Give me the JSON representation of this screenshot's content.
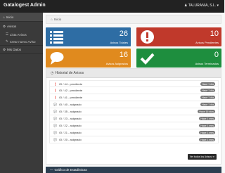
{
  "app": {
    "brand": "Gatalogest Admin",
    "user_label": "TALURANIA, S.L. ▾"
  },
  "sidebar": {
    "items": [
      {
        "label": "Inicio",
        "icon": "home-icon"
      },
      {
        "label": "Avisos",
        "icon": "gear-icon"
      },
      {
        "label": "Lista Avisos",
        "icon": "list-icon"
      },
      {
        "label": "Crear nuevo Aviso",
        "icon": "edit-icon"
      },
      {
        "label": "Mis Datos",
        "icon": "gear-icon"
      }
    ]
  },
  "breadcrumb": {
    "label": "Inicio"
  },
  "tiles": [
    {
      "number": "26",
      "label": "Avisos Totales",
      "color": "#2e6da4",
      "icon": "list-icon"
    },
    {
      "number": "10",
      "label": "Avisos Pendientes",
      "color": "#c0392b",
      "icon": "alert-icon"
    },
    {
      "number": "16",
      "label": "Avisos Asignados",
      "color": "#e08a1e",
      "icon": "comment-icon"
    },
    {
      "number": "0",
      "label": "Avisos Terminados",
      "color": "#1e8e3e",
      "icon": "check-icon"
    }
  ],
  "history": {
    "title": "Historial de Avisos",
    "rows": [
      {
        "icon": "alert-icon",
        "text": "OI / 44 - pendiente",
        "badge": "Hace 1 día"
      },
      {
        "icon": "alert-icon",
        "text": "OI / 42 - pendiente",
        "badge": "Hace 1 día"
      },
      {
        "icon": "alert-icon",
        "text": "OI / 41 - pendiente",
        "badge": "Hace 1 día"
      },
      {
        "icon": "comment-icon",
        "text": "OI / 40 - asignado",
        "badge": "Hace 1 día"
      },
      {
        "icon": "comment-icon",
        "text": "OI / 35 - asignado",
        "badge": "Hace 16 días"
      },
      {
        "icon": "comment-icon",
        "text": "OI / 23 - asignado",
        "badge": "Hace 1 mes"
      },
      {
        "icon": "comment-icon",
        "text": "OI / 22 - asignado",
        "badge": "Hace 1 mes"
      },
      {
        "icon": "comment-icon",
        "text": "OI / 21 - asignado",
        "badge": "Hace 1 mes"
      },
      {
        "icon": "comment-icon",
        "text": "OI / 20 - asignado",
        "badge": "Hace 1 mes"
      }
    ],
    "button_label": "Ver todos los Avisos ➜"
  },
  "stats": {
    "title": "Gráfico de Estadísticas"
  }
}
